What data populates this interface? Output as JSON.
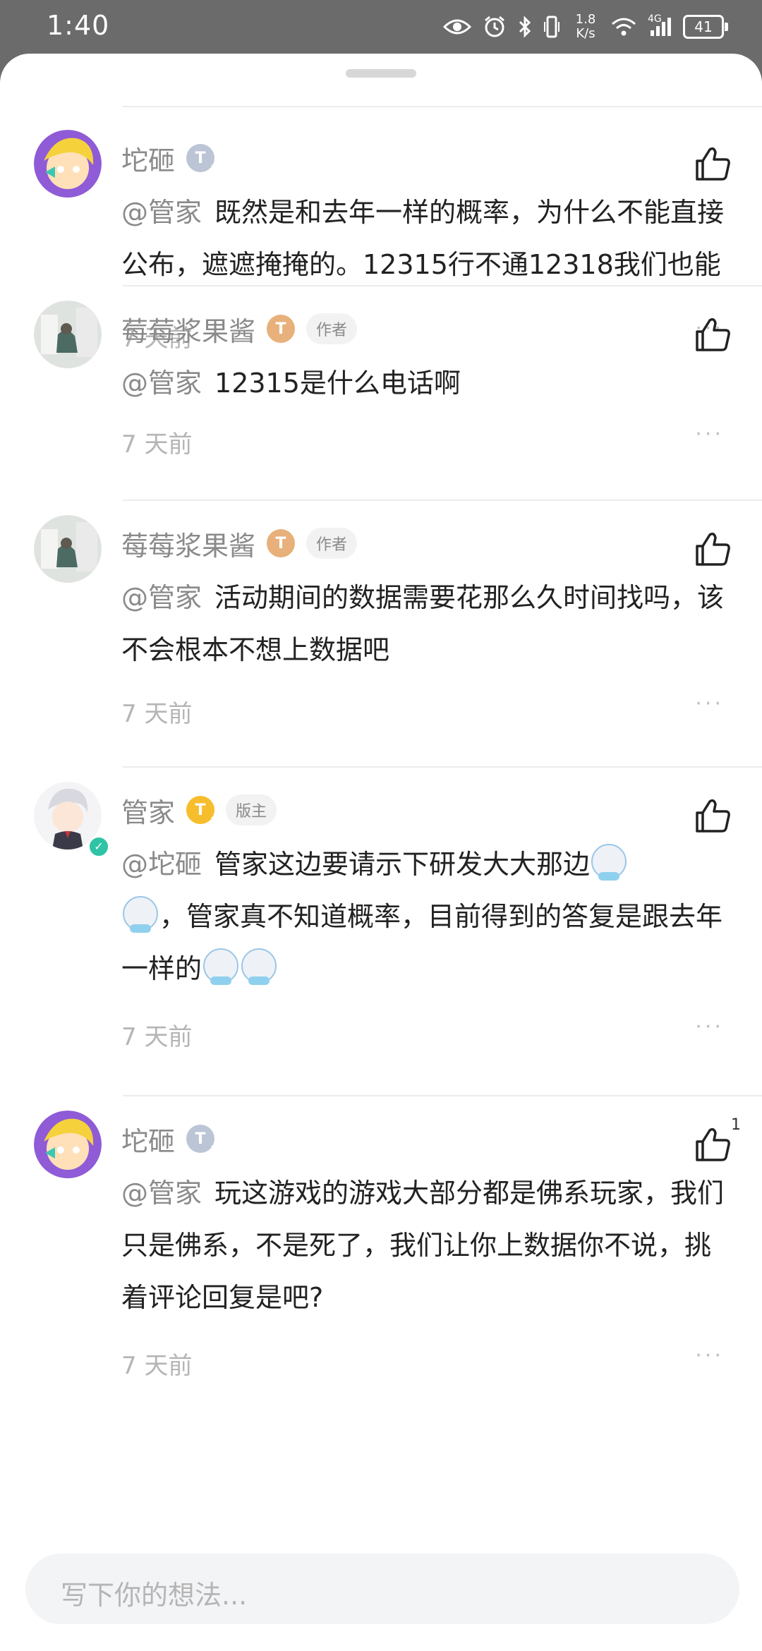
{
  "status_bar": {
    "time": "1:40",
    "net_speed_value": "1.8",
    "net_speed_unit": "K/s",
    "network": "4G",
    "battery": "41",
    "icons": [
      "eye-icon",
      "alarm-icon",
      "bluetooth-icon",
      "vibrate-icon",
      "wifi-icon",
      "signal-icon",
      "battery-icon"
    ]
  },
  "comments": [
    {
      "username": "坨砸",
      "level": "T",
      "level_sub": "3",
      "mention": "@管家",
      "text": "既然是和去年一样的概率，为什么不能直接公布，遮遮掩掩的。12315行不通12318我们也能",
      "time": "7 天前",
      "more": "···"
    },
    {
      "username": "莓莓浆果酱",
      "level": "T",
      "level_sub": "4",
      "role": "作者",
      "mention": "@管家",
      "text": "12315是什么电话啊",
      "time": "7 天前",
      "more": "···"
    },
    {
      "username": "莓莓浆果酱",
      "level": "T",
      "level_sub": "4",
      "role": "作者",
      "mention": "@管家",
      "text": "活动期间的数据需要花那么久时间找吗，该不会根本不想上数据吧",
      "time": "7 天前",
      "more": "···"
    },
    {
      "username": "管家",
      "level": "T",
      "level_sub": "1",
      "role": "版主",
      "mention": "@坨砸",
      "text_part1": "管家这边要请示下研发大大那边",
      "text_part2": "，管家真不知道概率，目前得到的答复是跟去年一样的",
      "time": "7 天前",
      "more": "···"
    },
    {
      "username": "坨砸",
      "level": "T",
      "level_sub": "3",
      "mention": "@管家",
      "text": "玩这游戏的游戏大部分都是佛系玩家，我们只是佛系，不是死了，我们让你上数据你不说，挑着评论回复是吧?",
      "time": "7 天前",
      "more": "···",
      "like_count": "1"
    }
  ],
  "input": {
    "placeholder": "写下你的想法..."
  }
}
